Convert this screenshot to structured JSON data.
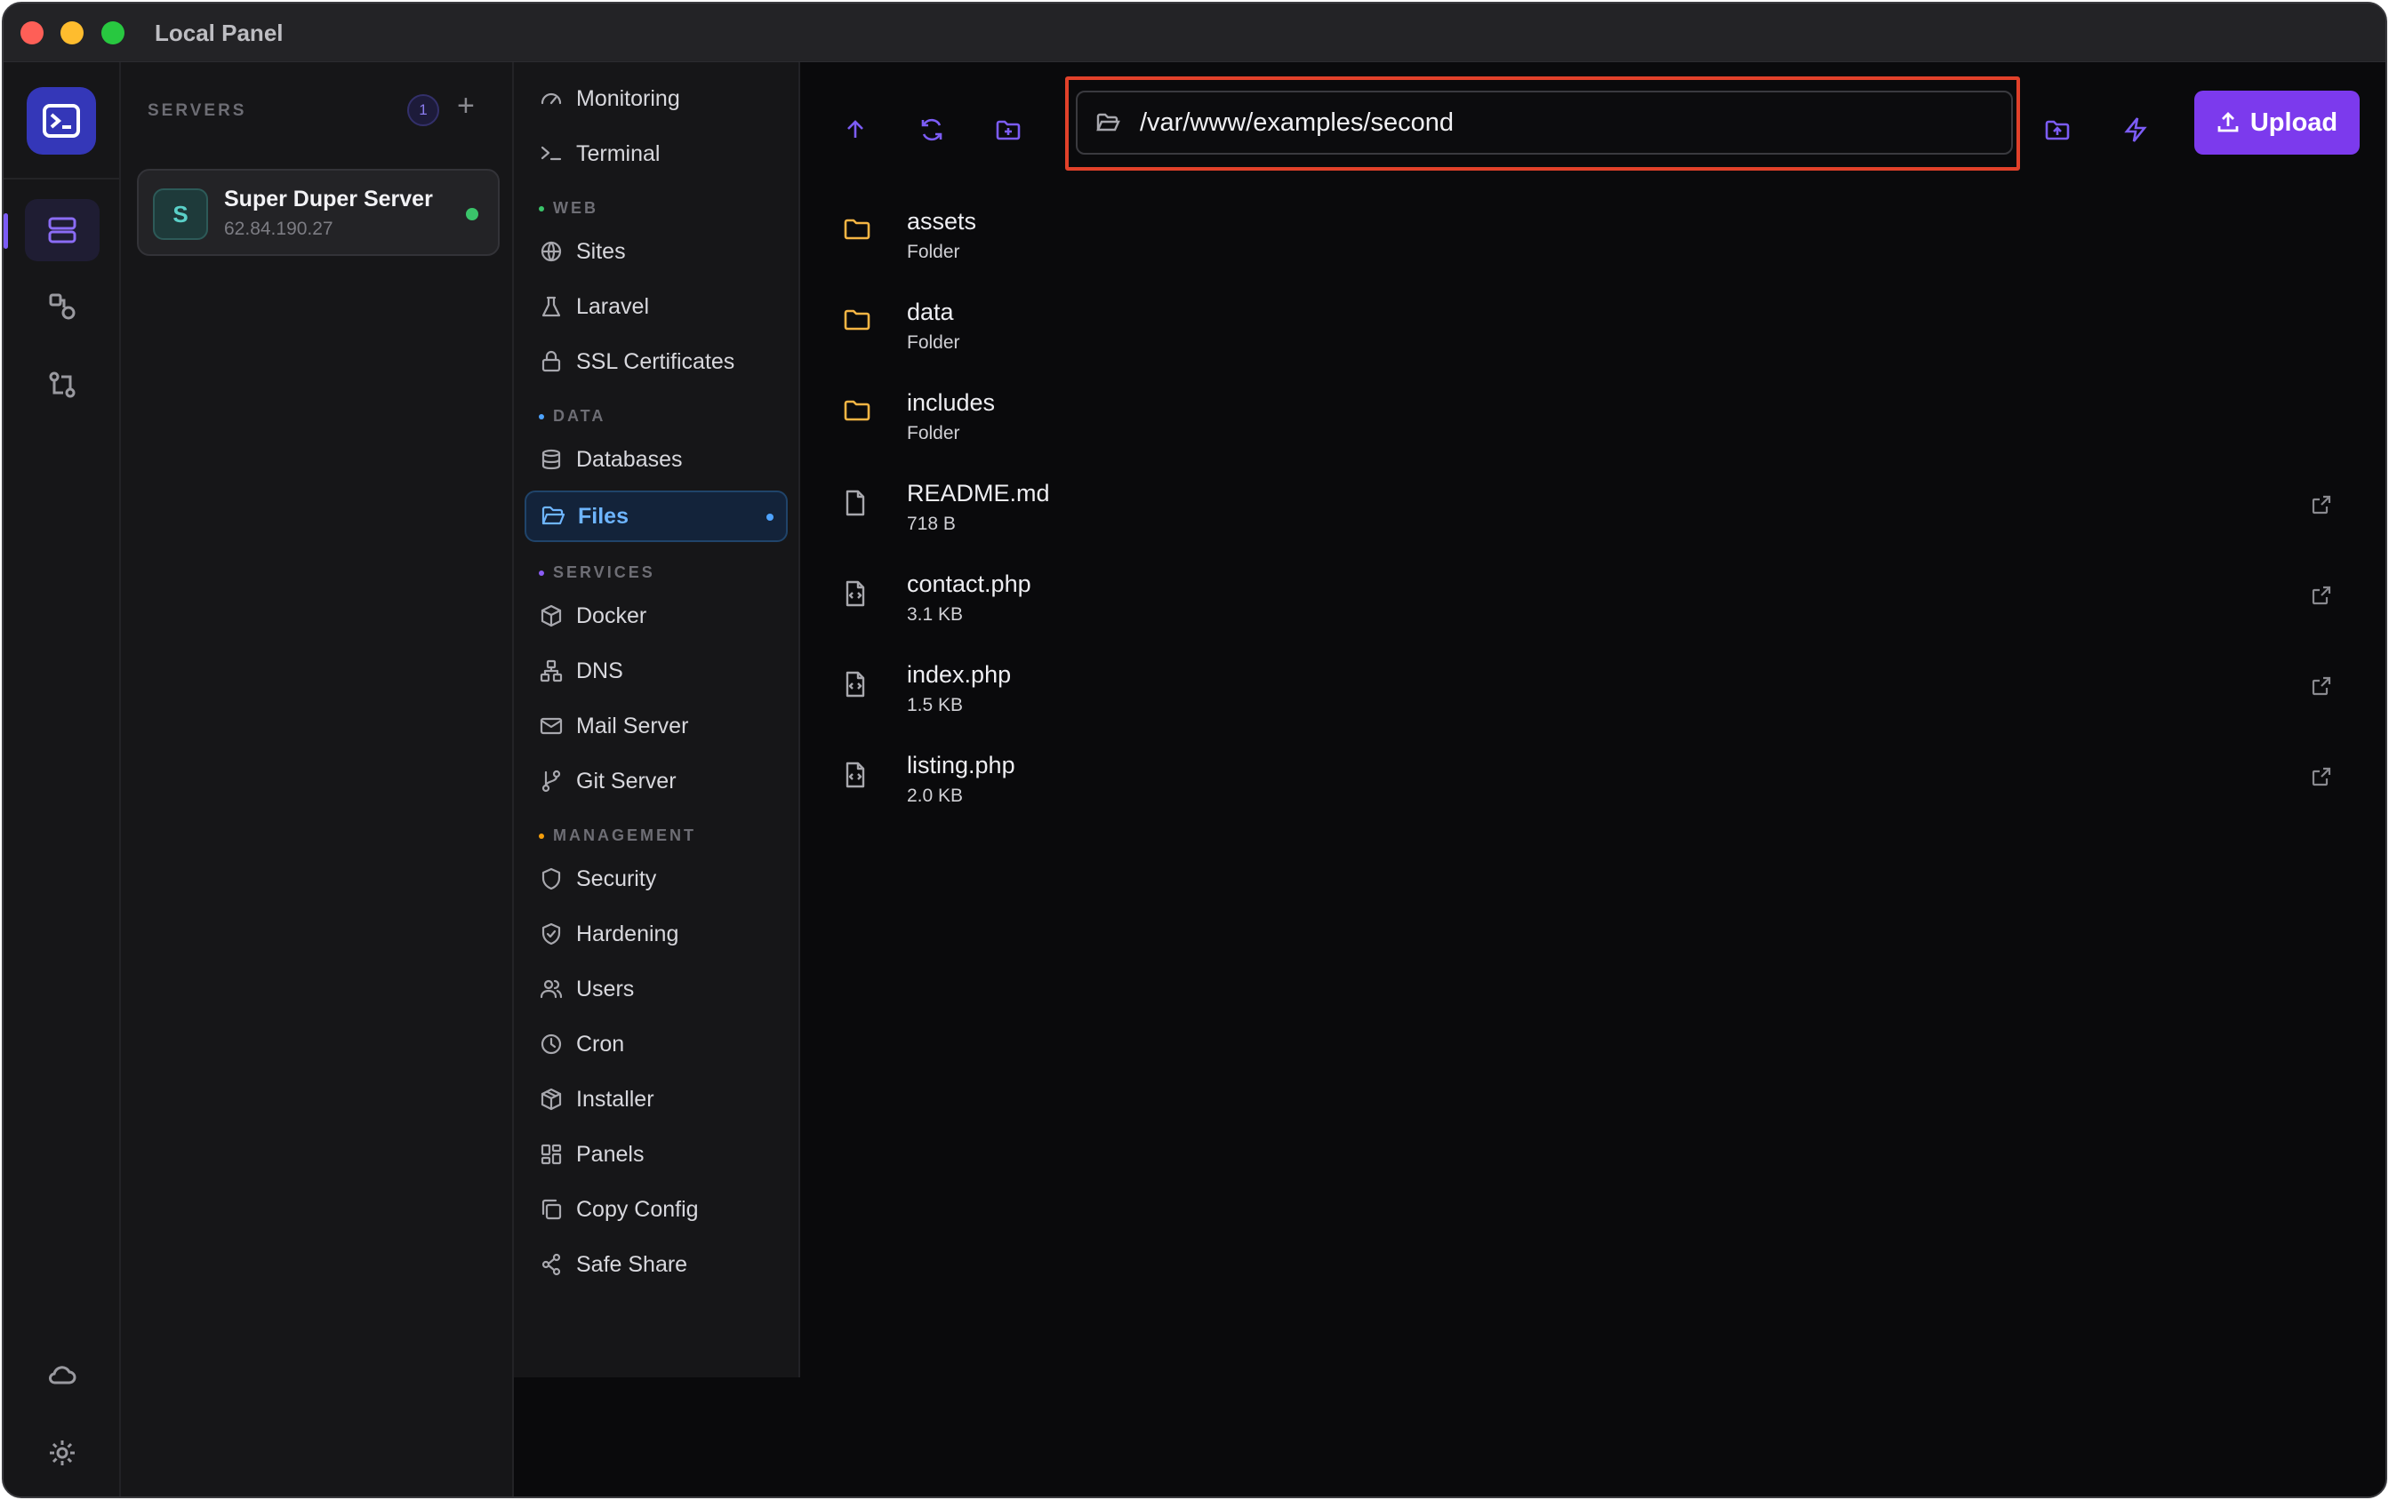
{
  "window": {
    "title": "Local Panel"
  },
  "servers_panel": {
    "header": "SERVERS",
    "count": "1",
    "add_label": "+",
    "server": {
      "initial": "S",
      "name": "Super Duper Server",
      "ip": "62.84.190.27",
      "status_color": "#3ac46a"
    }
  },
  "nav": {
    "top_items": [
      {
        "label": "Monitoring",
        "icon": "gauge-icon"
      },
      {
        "label": "Terminal",
        "icon": "terminal-icon"
      }
    ],
    "sections": [
      {
        "title": "WEB",
        "dot_color": "#3ac46a",
        "items": [
          {
            "label": "Sites",
            "icon": "globe-icon"
          },
          {
            "label": "Laravel",
            "icon": "flask-icon"
          },
          {
            "label": "SSL Certificates",
            "icon": "lock-icon"
          }
        ]
      },
      {
        "title": "DATA",
        "dot_color": "#4ea3ff",
        "items": [
          {
            "label": "Databases",
            "icon": "database-icon"
          },
          {
            "label": "Files",
            "icon": "folder-open-icon",
            "active": true
          }
        ]
      },
      {
        "title": "SERVICES",
        "dot_color": "#8b5cf6",
        "items": [
          {
            "label": "Docker",
            "icon": "package-icon"
          },
          {
            "label": "DNS",
            "icon": "network-icon"
          },
          {
            "label": "Mail Server",
            "icon": "mail-icon"
          },
          {
            "label": "Git Server",
            "icon": "git-branch-icon"
          }
        ]
      },
      {
        "title": "MANAGEMENT",
        "dot_color": "#f59e0b",
        "items": [
          {
            "label": "Security",
            "icon": "shield-icon"
          },
          {
            "label": "Hardening",
            "icon": "shield-check-icon"
          },
          {
            "label": "Users",
            "icon": "users-icon"
          },
          {
            "label": "Cron",
            "icon": "clock-icon"
          },
          {
            "label": "Installer",
            "icon": "box-icon"
          },
          {
            "label": "Panels",
            "icon": "grid-icon"
          },
          {
            "label": "Copy Config",
            "icon": "copy-icon"
          },
          {
            "label": "Safe Share",
            "icon": "share-icon"
          }
        ]
      }
    ]
  },
  "toolbar": {
    "path": "/var/www/examples/second",
    "upload_label": "Upload",
    "accent": "#7c3aed"
  },
  "files": [
    {
      "name": "assets",
      "meta": "Folder",
      "type": "folder"
    },
    {
      "name": "data",
      "meta": "Folder",
      "type": "folder"
    },
    {
      "name": "includes",
      "meta": "Folder",
      "type": "folder"
    },
    {
      "name": "README.md",
      "meta": "718 B",
      "type": "file"
    },
    {
      "name": "contact.php",
      "meta": "3.1 KB",
      "type": "code"
    },
    {
      "name": "index.php",
      "meta": "1.5 KB",
      "type": "code"
    },
    {
      "name": "listing.php",
      "meta": "2.0 KB",
      "type": "code"
    }
  ]
}
